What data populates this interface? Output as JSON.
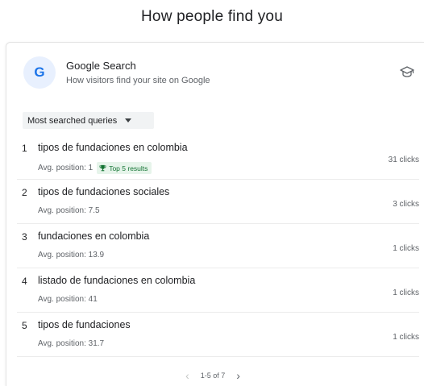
{
  "page": {
    "title": "How people find you"
  },
  "card": {
    "logo_letter": "G",
    "title": "Google Search",
    "subtitle": "How visitors find your site on Google",
    "icon": "graduation-cap-icon"
  },
  "filter": {
    "label": "Most searched queries"
  },
  "queries": [
    {
      "rank": "1",
      "query": "tipos de fundaciones en colombia",
      "position": "Avg. position: 1",
      "badge": "Top 5 results",
      "clicks": "31 clicks"
    },
    {
      "rank": "2",
      "query": "tipos de fundaciones sociales",
      "position": "Avg. position: 7.5",
      "clicks": "3 clicks"
    },
    {
      "rank": "3",
      "query": "fundaciones en colombia",
      "position": "Avg. position: 13.9",
      "clicks": "1 clicks"
    },
    {
      "rank": "4",
      "query": "listado de fundaciones en colombia",
      "position": "Avg. position: 41",
      "clicks": "1 clicks"
    },
    {
      "rank": "5",
      "query": "tipos de fundaciones",
      "position": "Avg. position: 31.7",
      "clicks": "1 clicks"
    }
  ],
  "pager": {
    "range": "1-5 of 7",
    "prev": "‹",
    "next": "›"
  },
  "colors": {
    "accent": "#1a73e8",
    "badge_bg": "#e6f4ea",
    "badge_text": "#137333"
  }
}
